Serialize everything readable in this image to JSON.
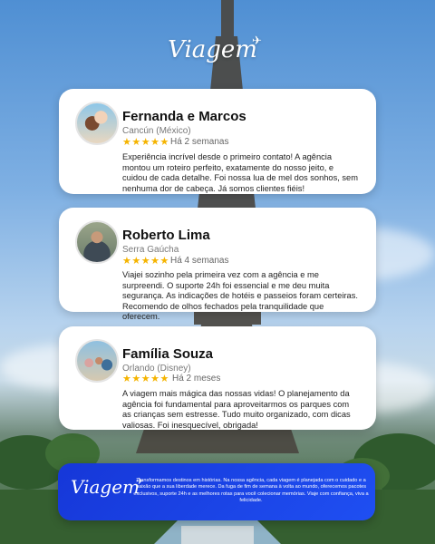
{
  "brand": {
    "logo_text": "Viagem",
    "plane_glyph": "✈",
    "accent": "#1f4ff2",
    "star_color": "#f5b400"
  },
  "testimonials": [
    {
      "name": "Fernanda e Marcos",
      "place": "Cancún (México)",
      "stars": "★★★★★",
      "rating": 5,
      "time": "Há 2 semanas",
      "text": "Experiência incrível desde o primeiro contato! A agência montou um roteiro perfeito, exatamente do nosso jeito, e cuidou de cada detalhe. Foi nossa lua de mel dos sonhos, sem nenhuma dor de cabeça. Já somos clientes fiéis!"
    },
    {
      "name": "Roberto Lima",
      "place": "Serra Gaúcha",
      "stars": "★★★★★",
      "rating": 5,
      "time": "Há 4 semanas",
      "text": "Viajei sozinho pela primeira vez com a agência e me surpreendi. O suporte 24h foi essencial e me deu muita segurança. As indicações de hotéis e passeios foram certeiras. Recomendo de olhos fechados pela tranquilidade que oferecem."
    },
    {
      "name": "Família Souza",
      "place": "Orlando (Disney)",
      "stars": "★★★★★",
      "rating": 5,
      "time": "Há 2 meses",
      "text": "A viagem mais mágica das nossas vidas! O planejamento da agência foi fundamental para aproveitarmos os parques com as crianças sem estresse. Tudo muito organizado, com dicas valiosas. Foi inesquecível, obrigada!"
    }
  ],
  "footer": {
    "logo_text": "Viagem",
    "text": "Transformamos destinos em histórias. Na nossa agência, cada viagem é planejada com o cuidado e a paixão que a sua liberdade merece. Da fuga de fim de semana à volta ao mundo, oferecemos pacotes exclusivos, suporte 24h e as melhores rotas para você colecionar memórias. Viaje com confiança, viva a felicidade."
  }
}
